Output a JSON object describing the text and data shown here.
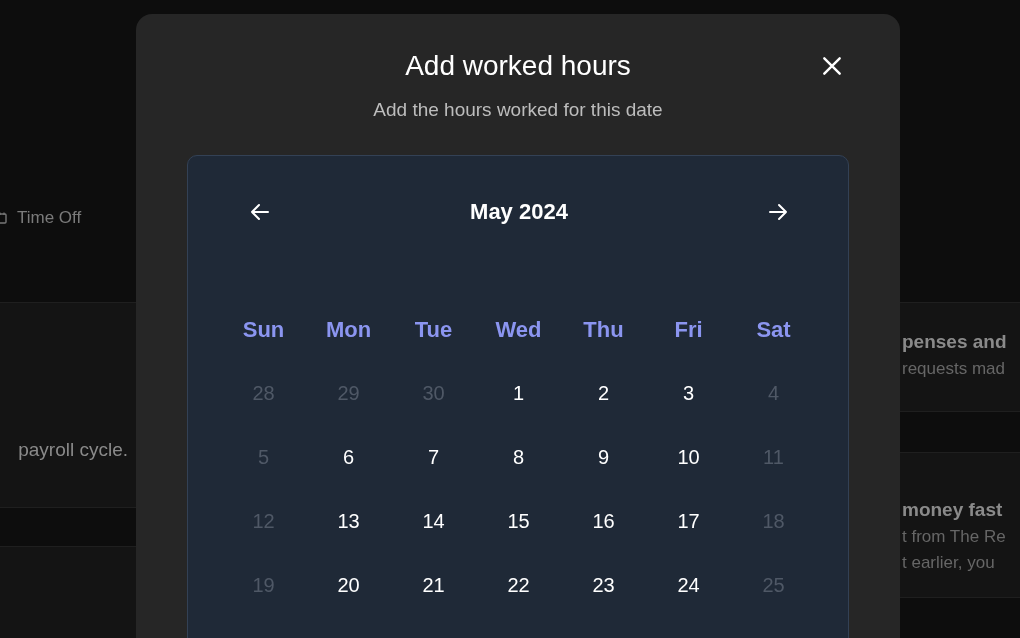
{
  "background": {
    "nav_item": {
      "label": "Time Off"
    },
    "left_panel": {
      "text": "payroll cycle."
    },
    "right_cards": [
      {
        "title": "penses and",
        "text_lines": [
          "requests mad"
        ]
      },
      {
        "title": "money fast",
        "text_lines": [
          "t from The Re",
          "t earlier, you"
        ]
      }
    ]
  },
  "dialog": {
    "title": "Add worked hours",
    "subtitle": "Add the hours worked for this date",
    "calendar": {
      "month": "May 2024",
      "weekdays": [
        "Sun",
        "Mon",
        "Tue",
        "Wed",
        "Thu",
        "Fri",
        "Sat"
      ],
      "weeks": [
        [
          {
            "day": "28",
            "disabled": true
          },
          {
            "day": "29",
            "disabled": true
          },
          {
            "day": "30",
            "disabled": true
          },
          {
            "day": "1",
            "disabled": false
          },
          {
            "day": "2",
            "disabled": false
          },
          {
            "day": "3",
            "disabled": false
          },
          {
            "day": "4",
            "disabled": true
          }
        ],
        [
          {
            "day": "5",
            "disabled": true
          },
          {
            "day": "6",
            "disabled": false
          },
          {
            "day": "7",
            "disabled": false
          },
          {
            "day": "8",
            "disabled": false
          },
          {
            "day": "9",
            "disabled": false
          },
          {
            "day": "10",
            "disabled": false
          },
          {
            "day": "11",
            "disabled": true
          }
        ],
        [
          {
            "day": "12",
            "disabled": true
          },
          {
            "day": "13",
            "disabled": false
          },
          {
            "day": "14",
            "disabled": false
          },
          {
            "day": "15",
            "disabled": false
          },
          {
            "day": "16",
            "disabled": false
          },
          {
            "day": "17",
            "disabled": false
          },
          {
            "day": "18",
            "disabled": true
          }
        ],
        [
          {
            "day": "19",
            "disabled": true
          },
          {
            "day": "20",
            "disabled": false
          },
          {
            "day": "21",
            "disabled": false
          },
          {
            "day": "22",
            "disabled": false
          },
          {
            "day": "23",
            "disabled": false
          },
          {
            "day": "24",
            "disabled": false
          },
          {
            "day": "25",
            "disabled": true
          }
        ]
      ]
    }
  }
}
